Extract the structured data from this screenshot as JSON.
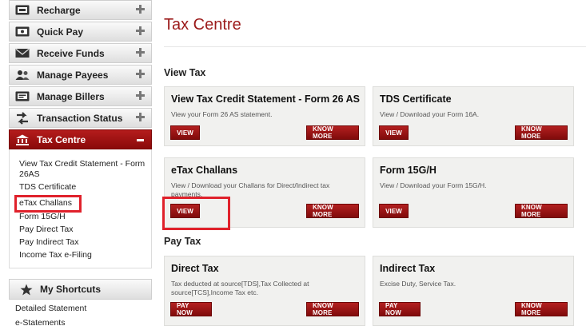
{
  "sidebar": {
    "items": [
      {
        "label": "Recharge",
        "icon": "recharge-icon"
      },
      {
        "label": "Quick Pay",
        "icon": "quick-pay-icon"
      },
      {
        "label": "Receive Funds",
        "icon": "envelope-icon"
      },
      {
        "label": "Manage Payees",
        "icon": "users-icon"
      },
      {
        "label": "Manage Billers",
        "icon": "biller-icon"
      },
      {
        "label": "Transaction Status",
        "icon": "transfer-icon"
      },
      {
        "label": "Tax Centre",
        "icon": "bank-icon"
      }
    ],
    "submenu": [
      "View Tax Credit Statement - Form 26AS",
      "TDS Certificate",
      "eTax Challans",
      "Form 15G/H",
      "Pay Direct Tax",
      "Pay Indirect Tax",
      "Income Tax e-Filing"
    ],
    "shortcuts": {
      "title": "My Shortcuts",
      "links": [
        "Detailed Statement",
        "e-Statements"
      ]
    }
  },
  "main": {
    "title": "Tax Centre",
    "view_tax": {
      "heading": "View Tax",
      "cards": [
        {
          "title": "View Tax Credit Statement - Form 26 AS",
          "desc": "View your Form 26 AS statement.",
          "button": "VIEW",
          "more": "KNOW MORE"
        },
        {
          "title": "TDS Certificate",
          "desc": "View / Download your Form 16A.",
          "button": "VIEW",
          "more": "KNOW MORE"
        },
        {
          "title": "eTax Challans",
          "desc": "View / Download your Challans for Direct/Indirect tax payments.",
          "button": "VIEW",
          "more": "KNOW MORE"
        },
        {
          "title": "Form 15G/H",
          "desc": "View / Download your Form 15G/H.",
          "button": "VIEW",
          "more": "KNOW MORE"
        }
      ]
    },
    "pay_tax": {
      "heading": "Pay Tax",
      "cards": [
        {
          "title": "Direct Tax",
          "desc": "Tax deducted at source[TDS],Tax Collected at source[TCS],Income Tax etc.",
          "button": "PAY NOW",
          "more": "KNOW MORE"
        },
        {
          "title": "Indirect Tax",
          "desc": "Excise Duty, Service Tax.",
          "button": "PAY NOW",
          "more": "KNOW MORE"
        }
      ]
    }
  },
  "colors": {
    "accent": "#9b1a1a",
    "button": "#a01616",
    "highlight": "#e0212b",
    "card_bg": "#f1f1ef"
  }
}
